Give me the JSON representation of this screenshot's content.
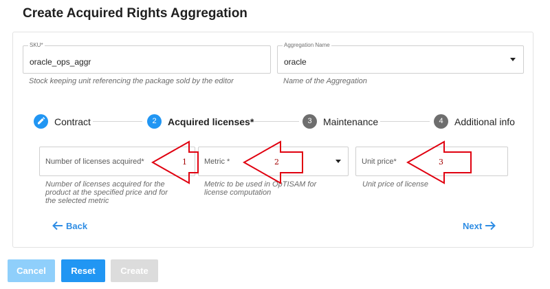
{
  "page": {
    "title": "Create Acquired Rights Aggregation"
  },
  "sku": {
    "label": "SKU*",
    "value": "oracle_ops_aggr",
    "hint": "Stock keeping unit referencing the package sold by the editor"
  },
  "aggregation": {
    "label": "Aggregation Name",
    "value": "oracle",
    "hint": "Name of the Aggregation"
  },
  "stepper": {
    "steps": [
      {
        "label": "Contract",
        "number": "",
        "state": "edit"
      },
      {
        "label": "Acquired licenses*",
        "number": "2",
        "state": "active"
      },
      {
        "label": "Maintenance",
        "number": "3",
        "state": "inactive"
      },
      {
        "label": "Additional info",
        "number": "4",
        "state": "inactive"
      }
    ]
  },
  "licenses_form": {
    "number_acquired": {
      "placeholder": "Number of licenses acquired*",
      "hint": [
        "Number of licenses acquired for the",
        "product at the specified price and for",
        "the selected metric"
      ]
    },
    "metric": {
      "placeholder": "Metric *",
      "hint": [
        "Metric to be used in OpTISAM for",
        "license computation"
      ]
    },
    "unit_price": {
      "placeholder": "Unit price*",
      "hint": [
        "Unit price of license"
      ]
    }
  },
  "callouts": [
    "1",
    "2",
    "3"
  ],
  "nav": {
    "back_label": "Back",
    "next_label": "Next"
  },
  "actions": {
    "cancel_label": "Cancel",
    "reset_label": "Reset",
    "create_label": "Create"
  },
  "colors": {
    "primary": "#2196f3",
    "step_inactive": "#6e6e6e",
    "callout_red": "#e0000f",
    "cancel_bg": "#8fcffb",
    "create_disabled": "#dcdcdc"
  }
}
